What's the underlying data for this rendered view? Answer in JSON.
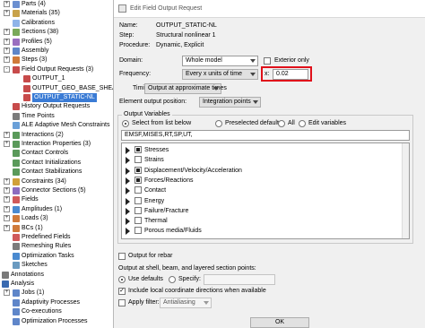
{
  "tree": {
    "items": [
      {
        "label": "Parts (4)",
        "indent": 14,
        "exp": "+",
        "color": "#6b8fd0"
      },
      {
        "label": "Materials (35)",
        "indent": 14,
        "exp": "+",
        "color": "#c8a24a"
      },
      {
        "label": "Calibrations",
        "indent": 14,
        "exp": "",
        "color": "#8fb4e8"
      },
      {
        "label": "Sections (38)",
        "indent": 14,
        "exp": "+",
        "color": "#7aa95a"
      },
      {
        "label": "Profiles (5)",
        "indent": 14,
        "exp": "+",
        "color": "#9a6fc0"
      },
      {
        "label": "Assembly",
        "indent": 14,
        "exp": "+",
        "color": "#5f86c9"
      },
      {
        "label": "Steps (3)",
        "indent": 14,
        "exp": "+",
        "color": "#d07a3a"
      },
      {
        "label": "Field Output Requests (3)",
        "indent": 14,
        "exp": "-",
        "color": "#c74b4b"
      },
      {
        "label": "OUTPUT_1",
        "indent": 26,
        "exp": "",
        "color": "#c74b4b"
      },
      {
        "label": "OUTPUT_GEO_BASE_SHEAR_TB",
        "indent": 26,
        "exp": "",
        "color": "#c74b4b"
      },
      {
        "label": "OUTPUT_STATIC-NL",
        "indent": 26,
        "exp": "",
        "color": "#c74b4b",
        "selected": true
      },
      {
        "label": "History Output Requests",
        "indent": 14,
        "exp": "",
        "color": "#c74b4b"
      },
      {
        "label": "Time Points",
        "indent": 14,
        "exp": "",
        "color": "#7b7b7b"
      },
      {
        "label": "ALE Adaptive Mesh Constraints",
        "indent": 14,
        "exp": "",
        "color": "#6aa0d8"
      },
      {
        "label": "Interactions (2)",
        "indent": 14,
        "exp": "+",
        "color": "#5a9a5a"
      },
      {
        "label": "Interaction Properties (3)",
        "indent": 14,
        "exp": "+",
        "color": "#5a9a5a"
      },
      {
        "label": "Contact Controls",
        "indent": 14,
        "exp": "",
        "color": "#5a9a5a"
      },
      {
        "label": "Contact Initializations",
        "indent": 14,
        "exp": "",
        "color": "#5a9a5a"
      },
      {
        "label": "Contact Stabilizations",
        "indent": 14,
        "exp": "",
        "color": "#5a9a5a"
      },
      {
        "label": "Constraints (34)",
        "indent": 14,
        "exp": "+",
        "color": "#d0a03a"
      },
      {
        "label": "Connector Sections (5)",
        "indent": 14,
        "exp": "+",
        "color": "#8c6cc0"
      },
      {
        "label": "Fields",
        "indent": 14,
        "exp": "+",
        "color": "#d05a5a"
      },
      {
        "label": "Amplitudes (1)",
        "indent": 14,
        "exp": "+",
        "color": "#4a8ad0"
      },
      {
        "label": "Loads (3)",
        "indent": 14,
        "exp": "+",
        "color": "#d07a3a"
      },
      {
        "label": "BCs (1)",
        "indent": 14,
        "exp": "+",
        "color": "#d07a3a"
      },
      {
        "label": "Predefined Fields",
        "indent": 14,
        "exp": "",
        "color": "#d05a5a"
      },
      {
        "label": "Remeshing Rules",
        "indent": 14,
        "exp": "",
        "color": "#7b7b7b"
      },
      {
        "label": "Optimization Tasks",
        "indent": 14,
        "exp": "",
        "color": "#4a8ad0"
      },
      {
        "label": "Sketches",
        "indent": 14,
        "exp": "",
        "color": "#6a9ac0"
      },
      {
        "label": "Annotations",
        "indent": 2,
        "exp": "+",
        "color": "#7a7a7a"
      },
      {
        "label": "Analysis",
        "indent": 2,
        "exp": "-",
        "color": "#3a6ab0"
      },
      {
        "label": "Jobs (1)",
        "indent": 14,
        "exp": "+",
        "color": "#5f86c9"
      },
      {
        "label": "Adaptivity Processes",
        "indent": 14,
        "exp": "",
        "color": "#5f86c9"
      },
      {
        "label": "Co-executions",
        "indent": 14,
        "exp": "",
        "color": "#5f86c9"
      },
      {
        "label": "Optimization Processes",
        "indent": 14,
        "exp": "",
        "color": "#5f86c9"
      }
    ]
  },
  "dialog": {
    "title": "Edit Field Output Request",
    "name_label": "Name:",
    "name_value": "OUTPUT_STATIC-NL",
    "step_label": "Step:",
    "step_value": "Structural nonlinear 1",
    "procedure_label": "Procedure:",
    "procedure_value": "Dynamic, Explicit",
    "domain_label": "Domain:",
    "domain_value": "Whole model",
    "exterior_only_label": "Exterior only",
    "frequency_label": "Frequency:",
    "frequency_value": "Every x units of time",
    "x_label": "x:",
    "x_value": "0.02",
    "timing_label": "Timing:",
    "timing_value": "Output at approximate times",
    "element_output_position_label": "Element output position:",
    "element_output_position_value": "Integration points",
    "output_variables_label": "Output Variables",
    "select_from_list_label": "Select from list below",
    "preselected_defaults_label": "Preselected defaults",
    "all_label": "All",
    "edit_variables_label": "Edit variables",
    "variables_text": "EMSF,MISES,RT,SP,UT,",
    "variable_rows": [
      {
        "label": "Stresses",
        "state": "partial"
      },
      {
        "label": "Strains",
        "state": "empty"
      },
      {
        "label": "Displacement/Velocity/Acceleration",
        "state": "partial"
      },
      {
        "label": "Forces/Reactions",
        "state": "partial"
      },
      {
        "label": "Contact",
        "state": "empty"
      },
      {
        "label": "Energy",
        "state": "empty"
      },
      {
        "label": "Failure/Fracture",
        "state": "empty"
      },
      {
        "label": "Thermal",
        "state": "empty"
      },
      {
        "label": "Porous media/Fluids",
        "state": "empty"
      }
    ],
    "output_for_rebar_label": "Output for rebar",
    "shell_points_label": "Output at shell, beam, and layered section points:",
    "use_defaults_label": "Use defaults",
    "specify_label": "Specify:",
    "local_coord_label": "Include local coordinate directions when available",
    "apply_filter_label": "Apply filter:",
    "filter_value": "Antialiasing",
    "ok_label": "OK"
  },
  "colors": {
    "selection": "#3a7bd5",
    "highlight_box": "#e0101a"
  }
}
